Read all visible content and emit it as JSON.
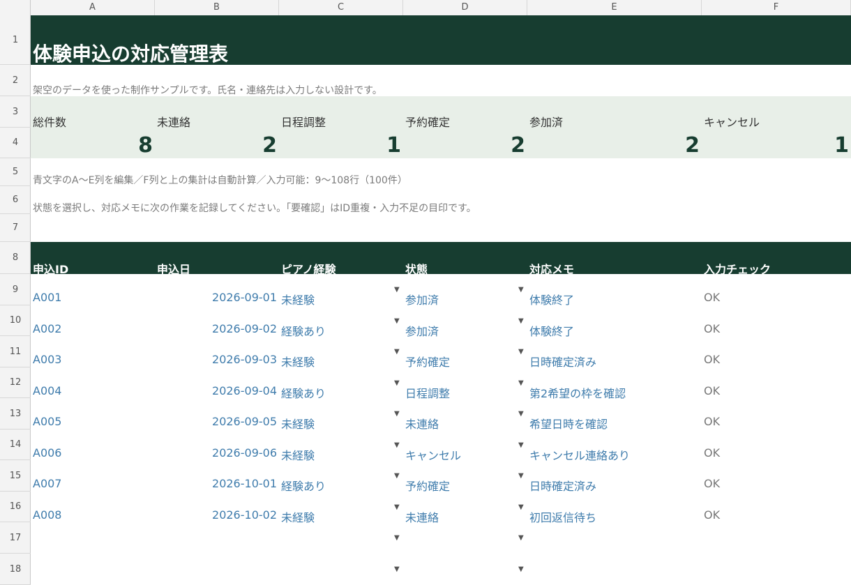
{
  "columns": [
    "A",
    "B",
    "C",
    "D",
    "E",
    "F"
  ],
  "rows": [
    "1",
    "2",
    "3",
    "4",
    "5",
    "6",
    "7",
    "8",
    "9",
    "10",
    "11",
    "12",
    "13",
    "14",
    "15",
    "16",
    "17",
    "18"
  ],
  "title": "体験申込の対応管理表",
  "subtitle": "架空のデータを使った制作サンプルです。氏名・連絡先は入力しない設計です。",
  "kpis": [
    {
      "label": "総件数",
      "value": "8"
    },
    {
      "label": "未連絡",
      "value": "2"
    },
    {
      "label": "日程調整",
      "value": "1"
    },
    {
      "label": "予約確定",
      "value": "2"
    },
    {
      "label": "参加済",
      "value": "2"
    },
    {
      "label": "キャンセル",
      "value": "1"
    }
  ],
  "notes": [
    "青文字のA〜E列を編集／F列と上の集計は自動計算／入力可能：9〜108行（100件）",
    "状態を選択し、対応メモに次の作業を記録してください。「要確認」はID重複・入力不足の目印です。"
  ],
  "headers": [
    "申込ID",
    "申込日",
    "ピアノ経験",
    "状態",
    "対応メモ",
    "入力チェック"
  ],
  "dropdown_glyph": "▼",
  "records": [
    {
      "id": "A001",
      "date": "2026-09-01",
      "exp": "未経験",
      "status": "参加済",
      "memo": "体験終了",
      "check": "OK"
    },
    {
      "id": "A002",
      "date": "2026-09-02",
      "exp": "経験あり",
      "status": "参加済",
      "memo": "体験終了",
      "check": "OK"
    },
    {
      "id": "A003",
      "date": "2026-09-03",
      "exp": "未経験",
      "status": "予約確定",
      "memo": "日時確定済み",
      "check": "OK"
    },
    {
      "id": "A004",
      "date": "2026-09-04",
      "exp": "経験あり",
      "status": "日程調整",
      "memo": "第2希望の枠を確認",
      "check": "OK"
    },
    {
      "id": "A005",
      "date": "2026-09-05",
      "exp": "未経験",
      "status": "未連絡",
      "memo": "希望日時を確認",
      "check": "OK"
    },
    {
      "id": "A006",
      "date": "2026-09-06",
      "exp": "未経験",
      "status": "キャンセル",
      "memo": "キャンセル連絡あり",
      "check": "OK"
    },
    {
      "id": "A007",
      "date": "2026-10-01",
      "exp": "経験あり",
      "status": "予約確定",
      "memo": "日時確定済み",
      "check": "OK"
    },
    {
      "id": "A008",
      "date": "2026-10-02",
      "exp": "未経験",
      "status": "未連絡",
      "memo": "初回返信待ち",
      "check": "OK"
    }
  ],
  "colors": {
    "header_band": "#173d30",
    "kpi_band": "#e8efe8",
    "editable_text": "#3f7cac"
  }
}
